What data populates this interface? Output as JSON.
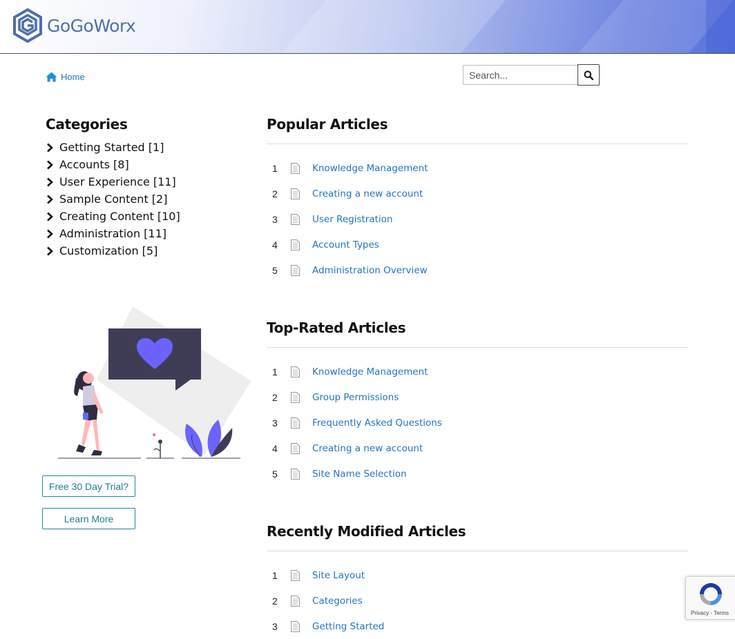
{
  "header": {
    "logo_text": "GoGoWorx",
    "brand_color": "#4f6ea8"
  },
  "breadcrumb": {
    "home_label": "Home",
    "icon": "home-icon"
  },
  "search": {
    "placeholder": "Search...",
    "icon": "search-icon"
  },
  "categories": {
    "title": "Categories",
    "items": [
      {
        "label": "Getting Started [1]"
      },
      {
        "label": "Accounts [8]"
      },
      {
        "label": "User Experience [11]"
      },
      {
        "label": "Sample Content [2]"
      },
      {
        "label": "Creating Content [10]"
      },
      {
        "label": "Administration [11]"
      },
      {
        "label": "Customization [5]"
      }
    ]
  },
  "sidebar_buttons": {
    "trial_label": "Free 30 Day Trial?",
    "learn_label": "Learn More"
  },
  "popular": {
    "title": "Popular Articles",
    "items": [
      {
        "num": "1",
        "title": "Knowledge Management"
      },
      {
        "num": "2",
        "title": "Creating a new account"
      },
      {
        "num": "3",
        "title": "User Registration"
      },
      {
        "num": "4",
        "title": "Account Types"
      },
      {
        "num": "5",
        "title": "Administration Overview"
      }
    ]
  },
  "top_rated": {
    "title": "Top-Rated Articles",
    "items": [
      {
        "num": "1",
        "title": "Knowledge Management"
      },
      {
        "num": "2",
        "title": "Group Permissions"
      },
      {
        "num": "3",
        "title": "Frequently Asked Questions"
      },
      {
        "num": "4",
        "title": "Creating a new account"
      },
      {
        "num": "5",
        "title": "Site Name Selection"
      }
    ]
  },
  "recent": {
    "title": "Recently Modified Articles",
    "items": [
      {
        "num": "1",
        "title": "Site Layout"
      },
      {
        "num": "2",
        "title": "Categories"
      },
      {
        "num": "3",
        "title": "Getting Started"
      }
    ]
  },
  "recaptcha": {
    "terms_text": "Privacy - Terms"
  },
  "colors": {
    "link": "#1f74c9",
    "button_border": "#1c8a9a",
    "accent_purple": "#6c63ff"
  }
}
